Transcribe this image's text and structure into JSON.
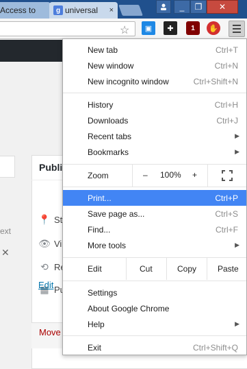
{
  "tabs": [
    {
      "label": "Access to",
      "close": "×"
    },
    {
      "favicon": "g",
      "label": "universal",
      "close": "×"
    }
  ],
  "window_controls": {
    "minimize": "_",
    "maximize": "❐",
    "close": "✕"
  },
  "page": {
    "publish_title": "Publi",
    "rows": [
      {
        "icon": "pin-icon",
        "text": "St"
      },
      {
        "icon": "eye-icon",
        "text": "Vi"
      },
      {
        "icon": "history-icon",
        "text": "Re"
      },
      {
        "icon": "calendar-icon",
        "text": "Pu"
      }
    ],
    "edit_link": "Edit",
    "move_link": "Move",
    "left_text": "ext"
  },
  "menu": {
    "new_tab": {
      "label": "New tab",
      "shortcut": "Ctrl+T"
    },
    "new_window": {
      "label": "New window",
      "shortcut": "Ctrl+N"
    },
    "new_incognito": {
      "label": "New incognito window",
      "shortcut": "Ctrl+Shift+N"
    },
    "history": {
      "label": "History",
      "shortcut": "Ctrl+H"
    },
    "downloads": {
      "label": "Downloads",
      "shortcut": "Ctrl+J"
    },
    "recent_tabs": {
      "label": "Recent tabs"
    },
    "bookmarks": {
      "label": "Bookmarks"
    },
    "zoom": {
      "label": "Zoom",
      "minus": "–",
      "value": "100%",
      "plus": "+"
    },
    "print": {
      "label": "Print...",
      "shortcut": "Ctrl+P"
    },
    "save_page": {
      "label": "Save page as...",
      "shortcut": "Ctrl+S"
    },
    "find": {
      "label": "Find...",
      "shortcut": "Ctrl+F"
    },
    "more_tools": {
      "label": "More tools"
    },
    "edit": {
      "label": "Edit",
      "cut": "Cut",
      "copy": "Copy",
      "paste": "Paste"
    },
    "settings": {
      "label": "Settings"
    },
    "about": {
      "label": "About Google Chrome"
    },
    "help": {
      "label": "Help"
    },
    "exit": {
      "label": "Exit",
      "shortcut": "Ctrl+Shift+Q"
    },
    "highlight_color": "#4285f4"
  },
  "extensions": {
    "ublock_badge": "1"
  }
}
